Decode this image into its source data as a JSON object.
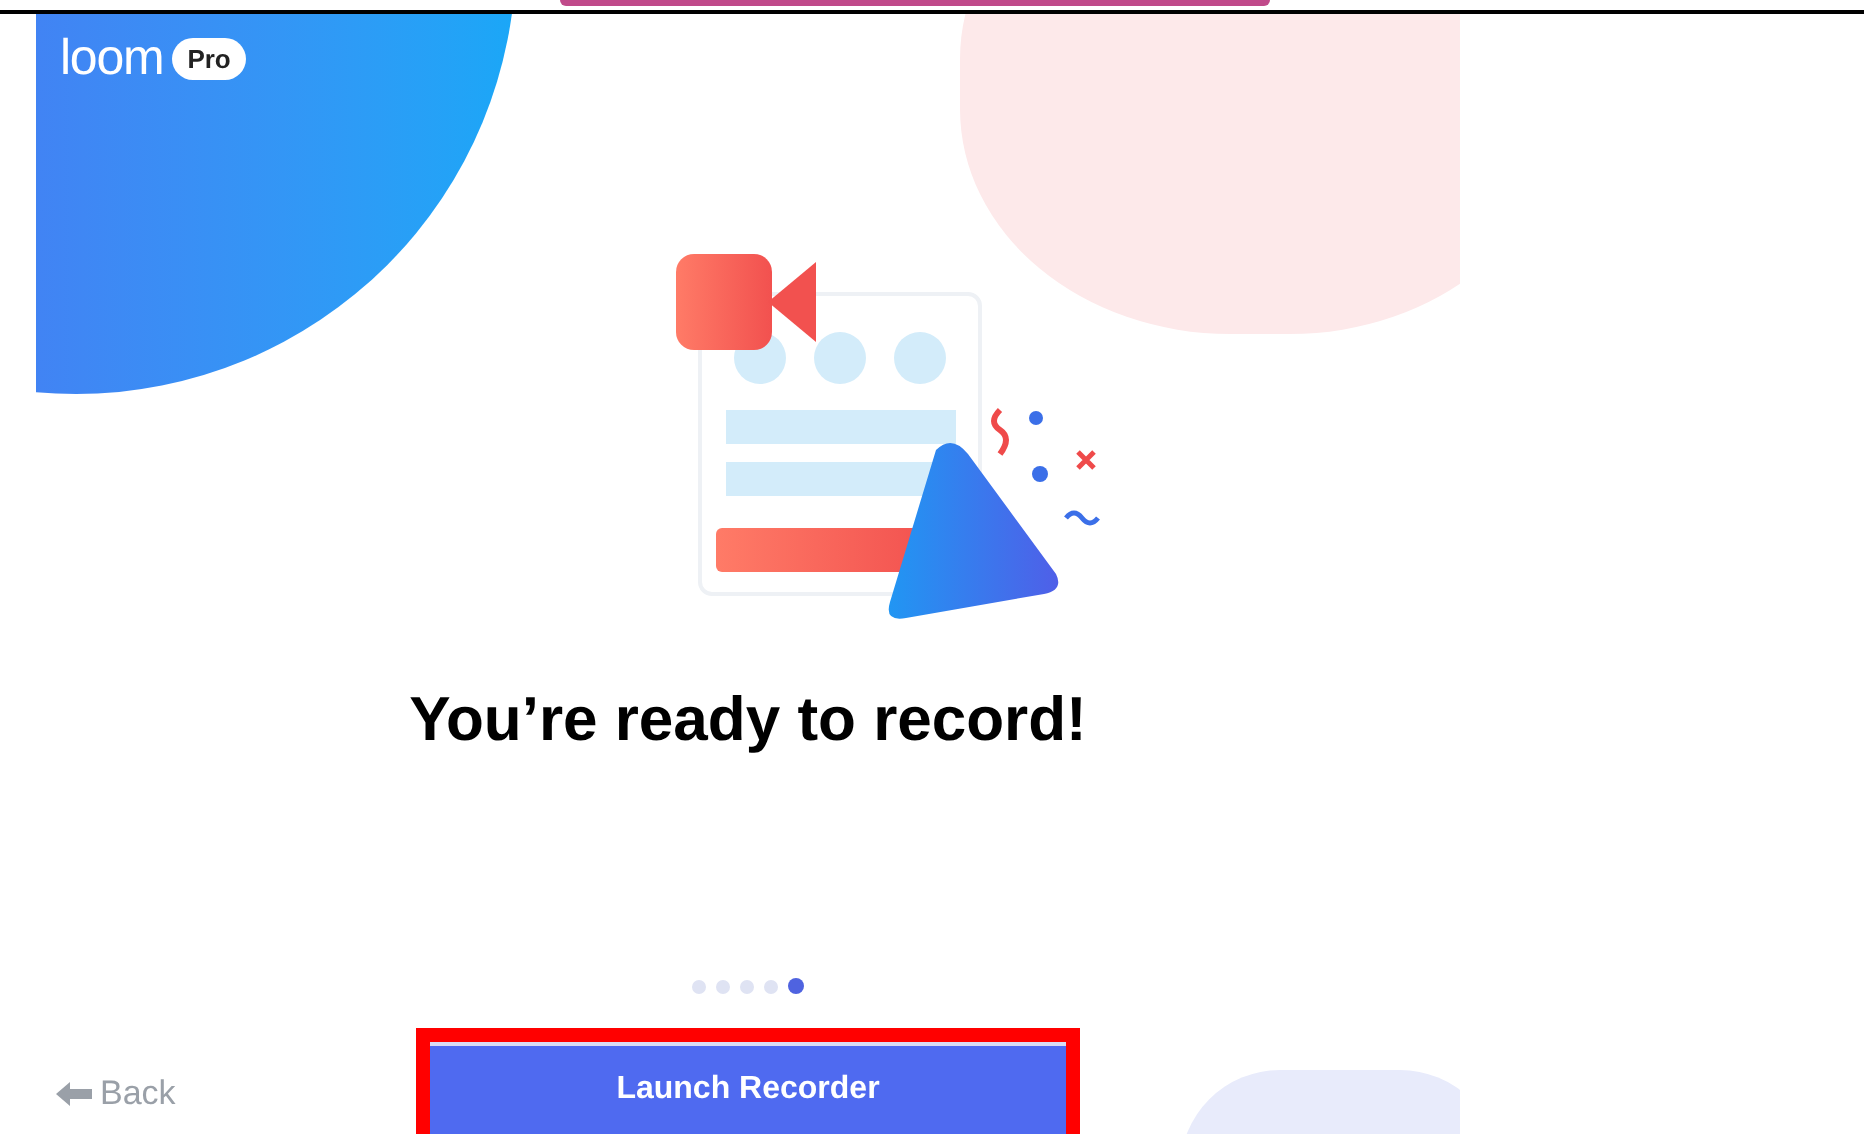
{
  "logo": {
    "wordmark": "loom",
    "badge": "Pro"
  },
  "headline": "You’re ready to record!",
  "steps": [
    {
      "selected": false
    },
    {
      "selected": false
    },
    {
      "selected": false
    },
    {
      "selected": false
    },
    {
      "selected": true
    }
  ],
  "back": {
    "label": "Back"
  },
  "primary_button": {
    "label": "Launch Recorder",
    "highlighted": true
  }
}
